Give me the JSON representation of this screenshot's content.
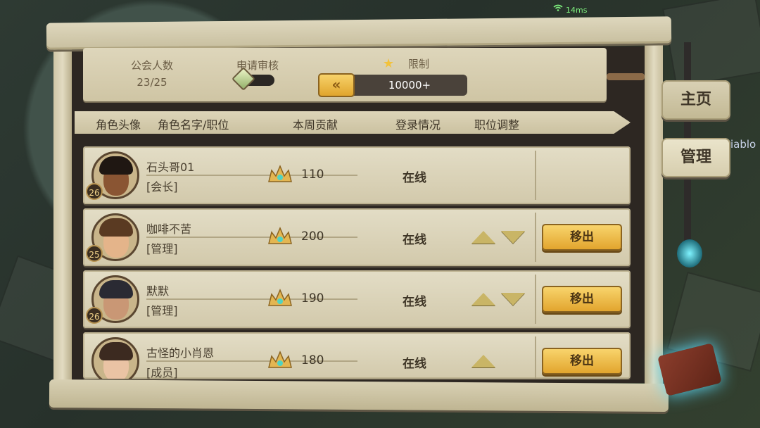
{
  "status": {
    "ping": "14ms"
  },
  "header": {
    "members_label": "公会人数",
    "members_value": "23/25",
    "review_label": "申请审核",
    "limit_label": "限制",
    "limit_value": "10000+",
    "arrow_label": "«"
  },
  "columns": {
    "avatar": "角色头像",
    "name_role": "角色名字/职位",
    "weekly": "本周贡献",
    "login": "登录情况",
    "adjust": "职位调整"
  },
  "rows": [
    {
      "level": "26",
      "name": "石头哥01",
      "role": "[会长]",
      "contribution": "110",
      "status": "在线",
      "remove": ""
    },
    {
      "level": "25",
      "name": "咖啡不苦",
      "role": "[管理]",
      "contribution": "200",
      "status": "在线",
      "remove": "移出"
    },
    {
      "level": "26",
      "name": "默默",
      "role": "[管理]",
      "contribution": "190",
      "status": "在线",
      "remove": "移出"
    },
    {
      "level": "",
      "name": "古怪的小肖恩",
      "role": "[成员]",
      "contribution": "180",
      "status": "在线",
      "remove": "移出"
    }
  ],
  "side": {
    "home": "主页",
    "manage": "管理",
    "side_text": "iablo"
  },
  "colors": {
    "button_gold": "#e9b13a",
    "panel": "#d8cfb2",
    "dark": "#2d2722"
  },
  "icons": [
    "wifi-icon",
    "star-icon",
    "double-chevron-left-icon",
    "crown-gem-icon",
    "up-triangle-icon",
    "down-triangle-icon",
    "book-icon"
  ]
}
